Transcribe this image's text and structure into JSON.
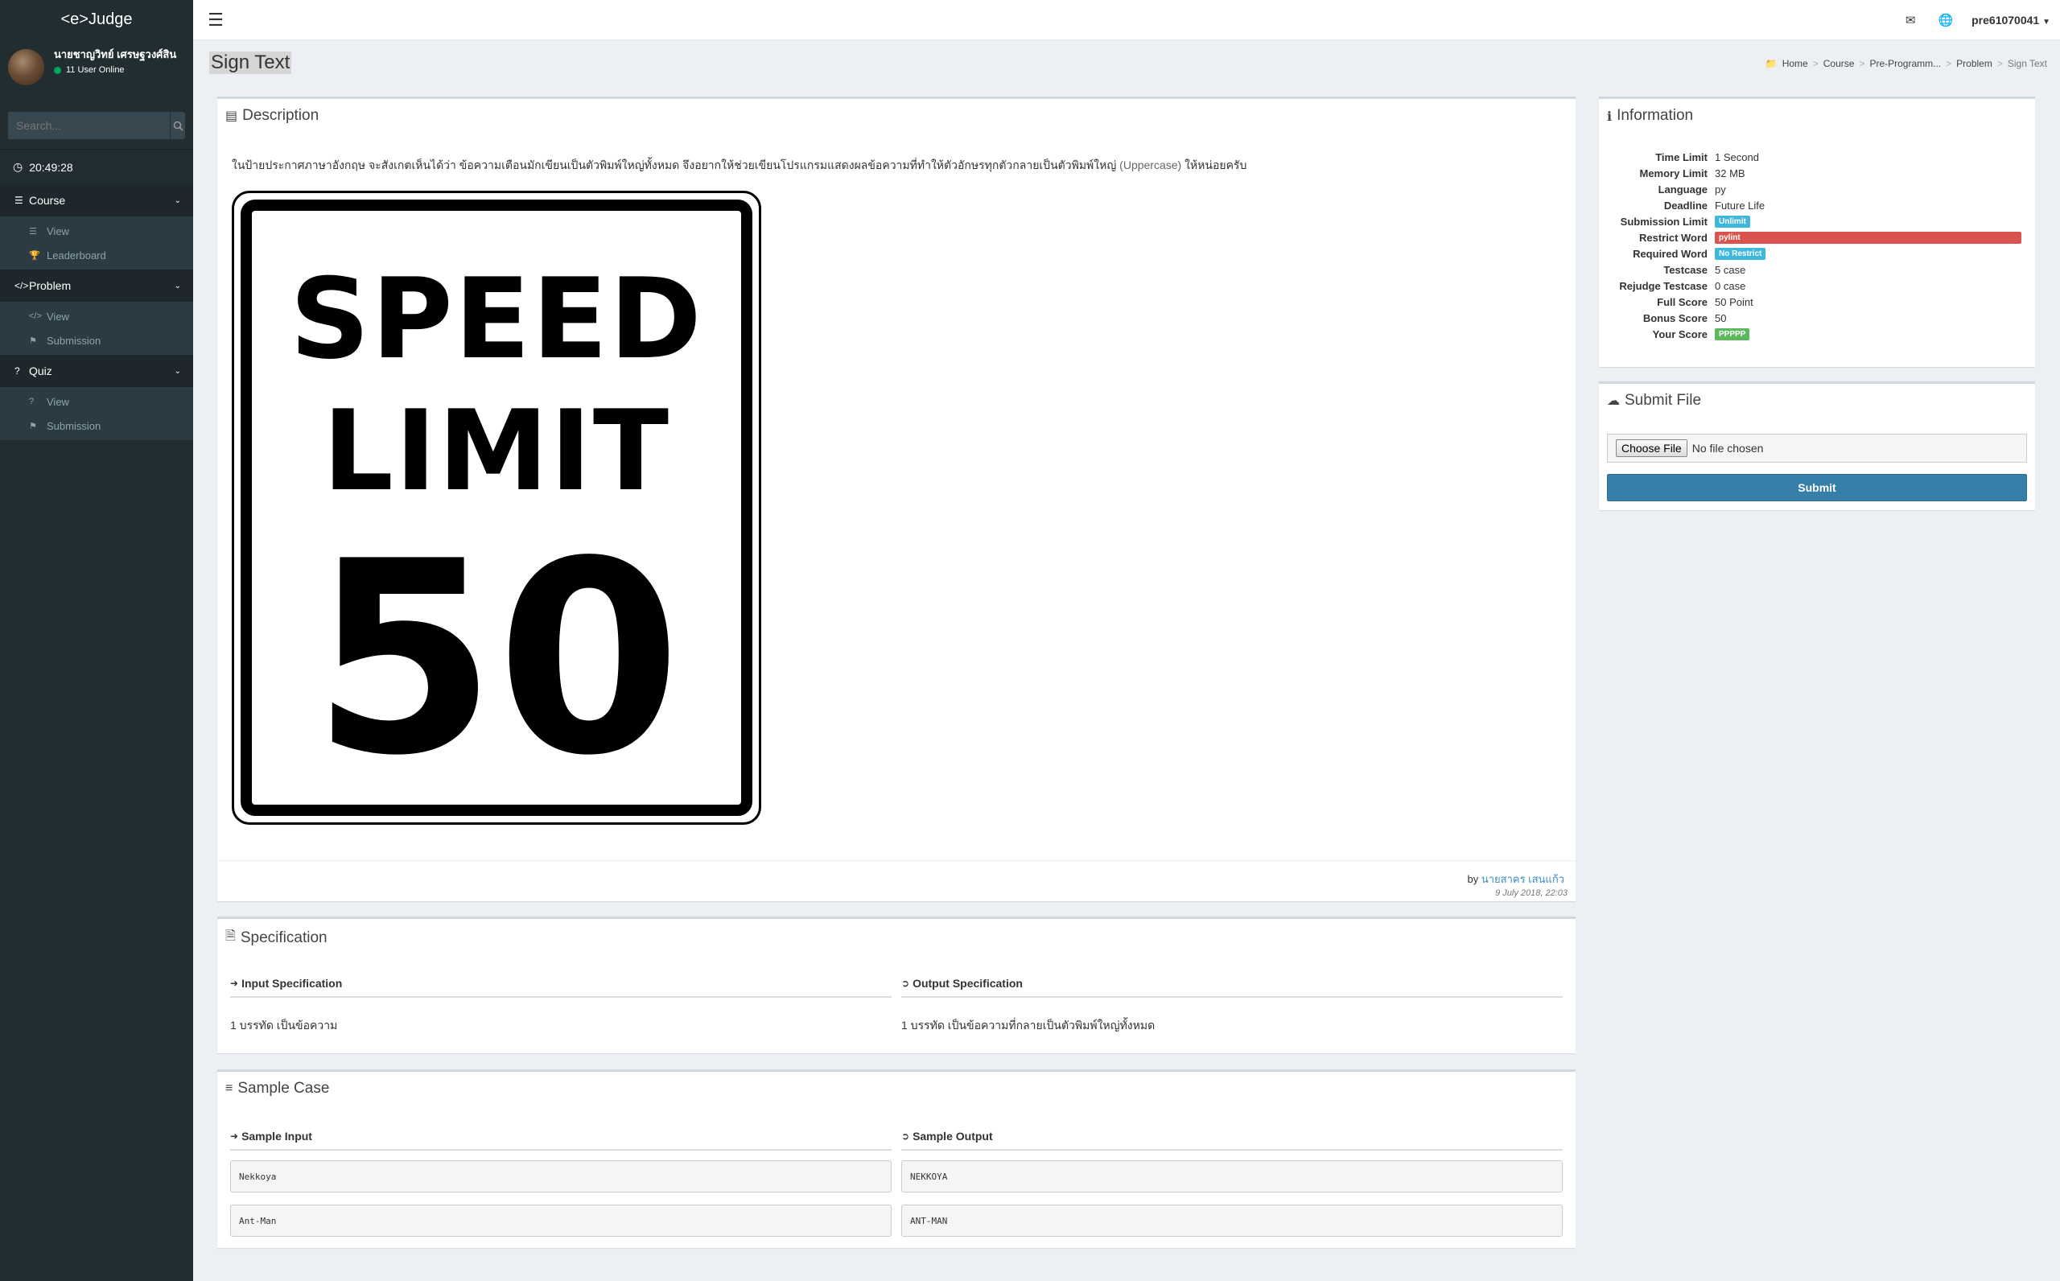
{
  "app": {
    "logo": "<e>Judge"
  },
  "user": {
    "name": "นายชาญวิทย์ เศรษฐวงศ์สิน",
    "online": "11 User Online"
  },
  "search": {
    "placeholder": "Search..."
  },
  "clock": "20:49:28",
  "sidebar": {
    "groups": [
      {
        "label": "Course",
        "items": [
          {
            "label": "View"
          },
          {
            "label": "Leaderboard"
          }
        ]
      },
      {
        "label": "Problem",
        "items": [
          {
            "label": "View"
          },
          {
            "label": "Submission"
          }
        ]
      },
      {
        "label": "Quiz",
        "items": [
          {
            "label": "View"
          },
          {
            "label": "Submission"
          }
        ]
      }
    ]
  },
  "topbar": {
    "username": "pre61070041"
  },
  "page": {
    "title": "Sign Text"
  },
  "breadcrumb": [
    "Home",
    "Course",
    "Pre-Programm...",
    "Problem",
    "Sign Text"
  ],
  "description": {
    "title": "Description",
    "text_before": "ในป้ายประกาศภาษาอังกฤษ จะสังเกตเห็นได้ว่า ข้อความเตือนมักเขียนเป็นตัวพิมพ์ใหญ่ทั้งหมด จึงอยากให้ช่วยเขียนโปรแกรมแสดงผลข้อความที่ทำให้ตัวอักษรทุกตัวกลายเป็นตัวพิมพ์ใหญ่",
    "text_hl": "(Uppercase)",
    "text_after": "ให้หน่อยครับ",
    "sign": {
      "line1": "SPEED",
      "line2": "LIMIT",
      "line3": "50"
    },
    "by": "by",
    "author": "นายสาคร เสนแก้ว",
    "date": "9 July 2018, 22:03"
  },
  "specification": {
    "title": "Specification",
    "input_label": "Input Specification",
    "output_label": "Output Specification",
    "input_text": "1 บรรทัด เป็นข้อความ",
    "output_text": "1 บรรทัด เป็นข้อความที่กลายเป็นตัวพิมพ์ใหญ่ทั้งหมด"
  },
  "sample": {
    "title": "Sample Case",
    "input_label": "Sample Input",
    "output_label": "Sample Output",
    "inputs": [
      "Nekkoya",
      "Ant-Man"
    ],
    "outputs": [
      "NEKKOYA",
      "ANT-MAN"
    ]
  },
  "information": {
    "title": "Information",
    "rows": [
      {
        "key": "Time Limit",
        "value": "1 Second"
      },
      {
        "key": "Memory Limit",
        "value": "32 MB"
      },
      {
        "key": "Language",
        "value": "py"
      },
      {
        "key": "Deadline",
        "value": "Future Life"
      },
      {
        "key": "Submission Limit",
        "value": "Unlimit"
      },
      {
        "key": "Restrict Word",
        "value": "pylint"
      },
      {
        "key": "Required Word",
        "value": "No Restrict"
      },
      {
        "key": "Testcase",
        "value": "5 case"
      },
      {
        "key": "Rejudge Testcase",
        "value": "0 case"
      },
      {
        "key": "Full Score",
        "value": "50 Point"
      },
      {
        "key": "Bonus Score",
        "value": "50"
      },
      {
        "key": "Your Score",
        "value": "PPPPP"
      }
    ]
  },
  "submit": {
    "title": "Submit File",
    "choose_label": "Choose File",
    "no_file": "No file chosen",
    "button": "Submit"
  },
  "colors": {
    "sidebar_bg": "#222d32",
    "primary": "#367fa9",
    "badge_blue": "#3fb6dc",
    "badge_red": "#d9534f",
    "badge_green": "#5cb85c"
  }
}
